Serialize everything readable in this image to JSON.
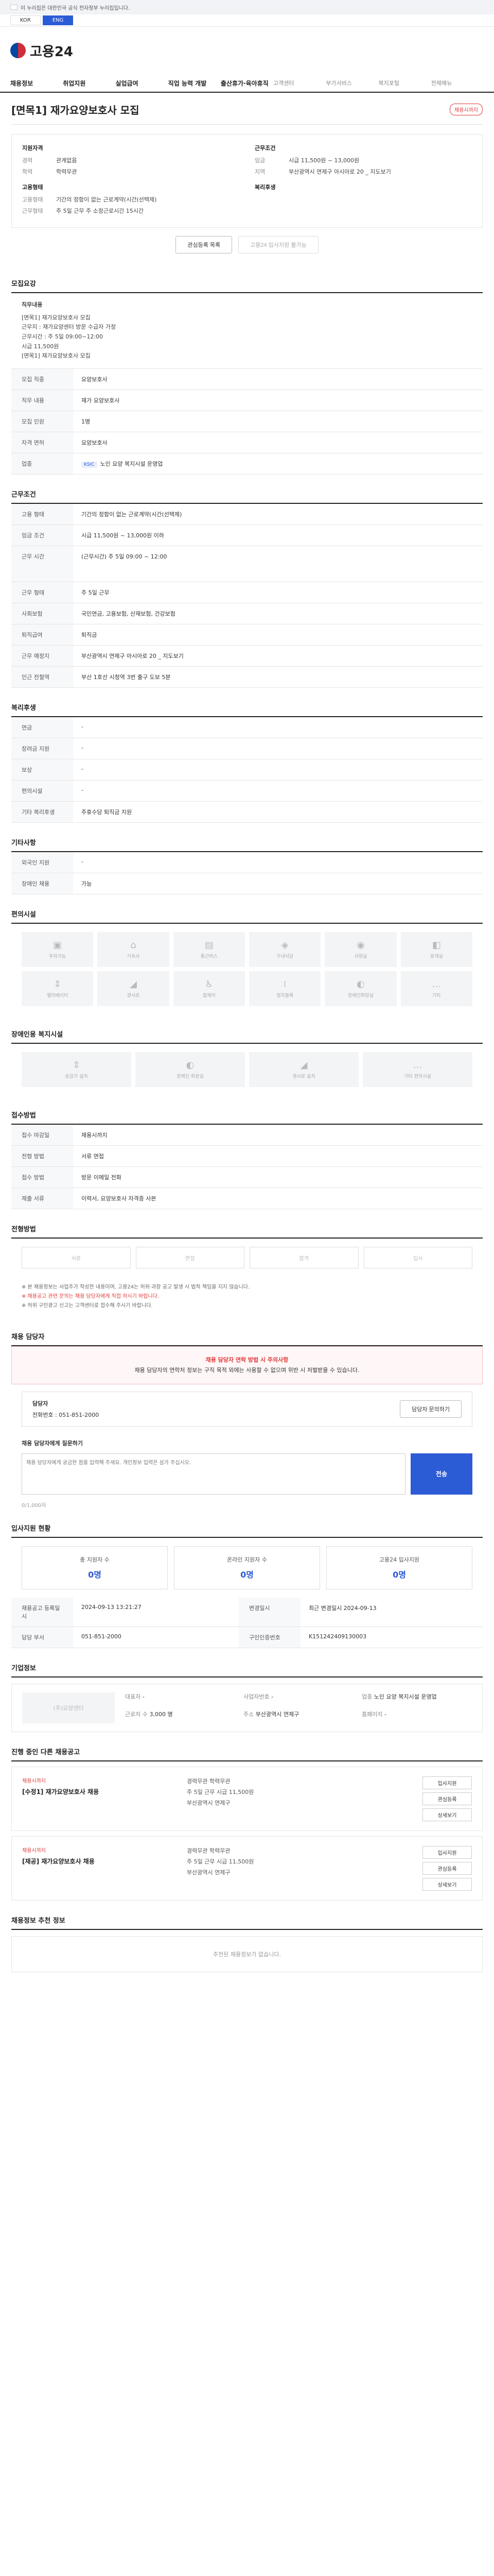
{
  "topbar": {
    "notice": "이 누리집은 대한민국 공식 전자정부 누리집입니다."
  },
  "lang_tabs": [
    "KOR",
    "ENG"
  ],
  "brand": {
    "name": "고용24"
  },
  "gnb": [
    "채용정보",
    "취업지원",
    "실업급여",
    "직업 능력 개발",
    "출산휴가·육아휴직",
    "고객센터",
    "부가서비스",
    "복지포털",
    "전체메뉴"
  ],
  "job": {
    "title": "[면목1] 재가요양보호사 모집",
    "dday": "채용시까지",
    "summary_left_title": "지원자격",
    "summary_right_title": "근무조건",
    "left": [
      {
        "k": "경력",
        "v": "관계없음"
      },
      {
        "k": "학력",
        "v": "학력무관"
      }
    ],
    "right": [
      {
        "k": "임금",
        "v": "시급 11,500원 ~ 13,000원"
      },
      {
        "k": "지역",
        "v": "부산광역시 연제구 아시아로 20 _ 지도보기"
      }
    ],
    "left2_title": "고용형태",
    "left2": [
      {
        "k": "고용형태",
        "v": "기간의 정함이 없는 근로계약(시간(선택제)"
      },
      {
        "k": "근무형태",
        "v": "주 5일 근무 주 소정근로시간 15시간"
      }
    ],
    "right2_title": "복리후생",
    "buttons": {
      "save": "관심등록 목록",
      "apply": "고용24 입사지원 불가능"
    }
  },
  "sections": {
    "detail": "모집요강",
    "detail_title": "직무내용",
    "detail_text": "[면목1] 재가요양보호사 모집\n근무지 : 재가요양센터 방문 수급자 가정\n근무시간 : 주 5일 09:00~12:00\n시급 11,500원\n[면목1] 재가요양보호사 모집",
    "qualification": "지원자격",
    "conditions": "근무조건",
    "welfare": "복리후생",
    "etc": "기타사항",
    "convenience": "편의시설",
    "disability": "장애인용 복지시설",
    "apply": "접수방법",
    "process": "전형방법",
    "manager": "채용 담당자",
    "stats": "입사지원 현황",
    "company": "기업정보",
    "other_jobs": "진행 중인 다른 채용공고",
    "recommend": "채용정보 추천 정보"
  },
  "detail_rows": [
    {
      "k": "모집 직종",
      "v": "요양보호사"
    },
    {
      "k": "직무 내용",
      "v": "재가 요양보호사"
    },
    {
      "k": "모집 인원",
      "v": "1명"
    },
    {
      "k": "자격 면허",
      "v": "요양보호사"
    },
    {
      "k": "업종",
      "v": "노인 요양 복지시설 운영업"
    }
  ],
  "condition_rows": [
    {
      "k": "고용 형태",
      "v": "기간의 정함이 없는 근로계약(시간(선택제)"
    },
    {
      "k": "임금 조건",
      "v": "시급 11,500원 ~ 13,000원 이하"
    },
    {
      "k": "근무 시간",
      "v": "(근무시간) 주 5일 09:00 ~ 12:00"
    },
    {
      "k": "근무 형태",
      "v": "주 5일 근무"
    },
    {
      "k": "사회보험",
      "v": "국민연금, 고용보험, 산재보험, 건강보험"
    },
    {
      "k": "퇴직급여",
      "v": "퇴직금"
    },
    {
      "k": "근무 예정지",
      "v": "부산광역시 연제구 아시아로 20 _ 지도보기"
    },
    {
      "k": "인근 전철역",
      "v": "부산 1호선 시청역 3번 출구 도보 5분"
    }
  ],
  "welfare_rows": [
    {
      "k": "연금",
      "v": "-"
    },
    {
      "k": "장려금 지원",
      "v": "-"
    },
    {
      "k": "보상",
      "v": "-"
    },
    {
      "k": "편의시설",
      "v": "-"
    },
    {
      "k": "기타 복리후생",
      "v": "주휴수당 퇴직금 지원"
    }
  ],
  "etc_rows": [
    {
      "k": "외국인 지원",
      "v": "-"
    },
    {
      "k": "장애인 채용",
      "v": "가능"
    }
  ],
  "convenience_items": [
    "주차가능",
    "기숙사",
    "통근버스",
    "구내식당",
    "샤워실",
    "휴게실",
    "엘리베이터",
    "경사로",
    "휠체어",
    "점자블록",
    "장애인화장실",
    "기타"
  ],
  "disability_items": [
    "승강기 설치",
    "장애인 화장실",
    "경사로 설치",
    "기타 편의시설"
  ],
  "apply_rows": [
    {
      "k": "접수 마감일",
      "v": "채용시까지"
    },
    {
      "k": "전형 방법",
      "v": "서류 면접"
    },
    {
      "k": "접수 방법",
      "v": "방문 이메일 전화"
    },
    {
      "k": "제출 서류",
      "v": "이력서, 요양보호사 자격증 사본"
    }
  ],
  "process_steps": [
    "서류",
    "면접",
    "합격",
    "입사"
  ],
  "process_notes": [
    "※ 본 채용정보는 사업주가 작성한 내용이며, 고용24는 허위·과장 공고 발생 시 법적 책임을 지지 않습니다.",
    "※ 채용공고 관련 문의는 채용 담당자에게 직접 하시기 바랍니다.",
    "※ 허위 구인광고 신고는 고객센터로 접수해 주시기 바랍니다."
  ],
  "manager_alert": {
    "title": "채용 담당자 연락 방법 시 주의사항",
    "body": "채용 담당자의 연락처 정보는 구직 목적 외에는 사용할 수 없으며 위반 시 처벌받을 수 있습니다."
  },
  "manager": {
    "label": "담당자",
    "phone": "전화번호 : 051-851-2000",
    "contact_btn": "담당자 문의하기"
  },
  "question": {
    "label": "채용 담당자에게 질문하기",
    "placeholder": "채용 담당자에게 궁금한 점을 입력해 주세요. 개인정보 입력은 삼가 주십시오.",
    "send": "전송",
    "count": "0/1,000자"
  },
  "stats": [
    {
      "label": "총 지원자 수",
      "value": "0명"
    },
    {
      "label": "온라인 지원자 수",
      "value": "0명"
    },
    {
      "label": "고용24 입사지원",
      "value": "0명"
    }
  ],
  "notice_rows": [
    {
      "k": "채용공고 등록일시",
      "v": "2024-09-13 13:21:27"
    },
    {
      "k": "변경일시",
      "v": "최근 변경일시 2024-09-13"
    },
    {
      "k": "담당 부서",
      "v": "051-851-2000"
    },
    {
      "k": "구인인증번호",
      "v": "K151242409130003"
    }
  ],
  "company": {
    "name": "(주)요양센터",
    "rows": [
      {
        "k": "대표자",
        "v": "-"
      },
      {
        "k": "사업자번호",
        "v": "-"
      },
      {
        "k": "업종",
        "v": "노인 요양 복지시설 운영업"
      },
      {
        "k": "근로자 수",
        "v": "3,000 명"
      },
      {
        "k": "주소",
        "v": "부산광역시 연제구"
      },
      {
        "k": "홈페이지",
        "v": "-"
      }
    ]
  },
  "other_jobs": [
    {
      "company": "채용시까지",
      "title": "[수정1] 재가요양보호사 채용",
      "info": [
        "경력무관 학력무관",
        "주 5일 근무 시급 11,500원",
        "부산광역시 연제구"
      ]
    },
    {
      "company": "채용시까지",
      "title": "[재공] 재가요양보호사 채용",
      "info": [
        "경력무관 학력무관",
        "주 5일 근무 시급 11,500원",
        "부산광역시 연제구"
      ]
    }
  ],
  "other_btns": [
    "입사지원",
    "관심등록",
    "상세보기"
  ],
  "recommend_empty": "추천된 채용정보가 없습니다."
}
